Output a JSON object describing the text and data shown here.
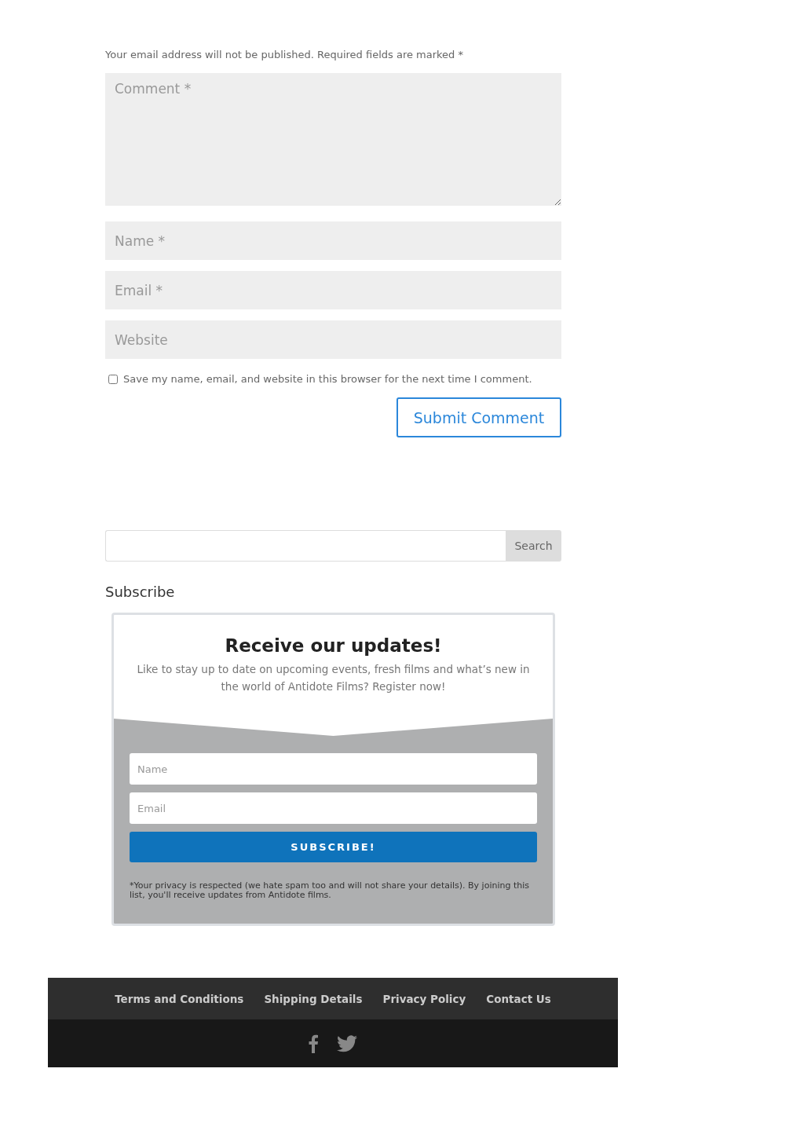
{
  "comment_form": {
    "notice": "Your email address will not be published. Required fields are marked *",
    "comment": {
      "placeholder": "Comment *"
    },
    "fields": [
      {
        "placeholder": "Name *"
      },
      {
        "placeholder": "Email *"
      },
      {
        "placeholder": "Website"
      }
    ],
    "save_info": {
      "label": "Save my name, email, and website in this browser for the next time I comment.",
      "checked": false
    },
    "submit": "Submit Comment"
  },
  "search": {
    "button": "Search"
  },
  "subscribe": {
    "heading": "Subscribe",
    "title": "Receive our updates!",
    "description": "Like to stay up to date on upcoming events, fresh films and what’s new in the world of Antidote Films? Register now!",
    "fields": [
      {
        "placeholder": "Name"
      },
      {
        "placeholder": "Email"
      }
    ],
    "button": "SUBSCRIBE!",
    "privacy": "*Your privacy is respected (we hate spam too and will not share your details). By joining this list, you'll receive updates from Antidote films."
  },
  "footer": {
    "links": [
      "Terms and Conditions",
      "Shipping Details",
      "Privacy Policy",
      "Contact Us"
    ],
    "social": [
      {
        "kind": "facebook"
      },
      {
        "kind": "twitter"
      }
    ]
  }
}
